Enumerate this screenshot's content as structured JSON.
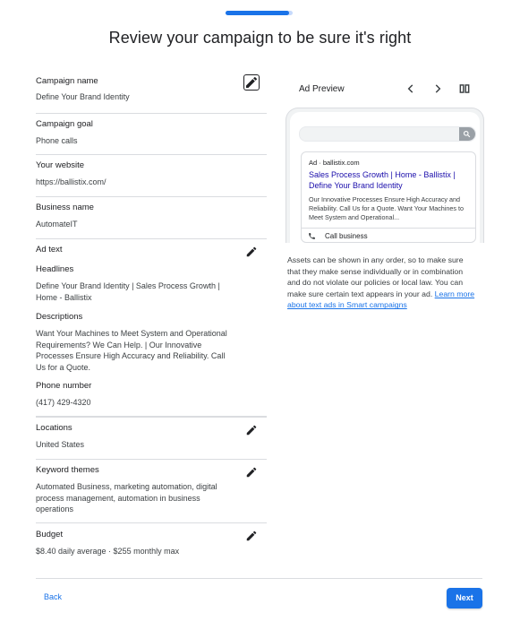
{
  "progress": {
    "fraction": 0.95
  },
  "page_title": "Review your campaign to be sure it's right",
  "sections": {
    "campaign_name": {
      "label": "Campaign name",
      "value": "Define Your Brand Identity"
    },
    "campaign_goal": {
      "label": "Campaign goal",
      "value": "Phone calls"
    },
    "website": {
      "label": "Your website",
      "value": "https://ballistix.com/"
    },
    "business_name": {
      "label": "Business name",
      "value": "AutomateIT"
    },
    "ad_text": {
      "label": "Ad text",
      "headlines_label": "Headlines",
      "headlines_value": "Define Your Brand Identity | Sales Process Growth | Home - Ballistix",
      "descriptions_label": "Descriptions",
      "descriptions_value": "Want Your Machines to Meet System and Operational Requirements? We Can Help. | Our Innovative Processes Ensure High Accuracy and Reliability. Call Us for a Quote.",
      "phone_label": "Phone number",
      "phone_value": "(417) 429-4320"
    },
    "locations": {
      "label": "Locations",
      "value": "United States"
    },
    "keyword_themes": {
      "label": "Keyword themes",
      "value": "Automated Business, marketing automation, digital process management, automation in business operations"
    },
    "budget": {
      "label": "Budget",
      "value": "$8.40 daily average · $255 monthly max"
    }
  },
  "preview": {
    "title": "Ad Preview",
    "ad_meta": "Ad · ballistix.com",
    "headline": "Sales Process Growth | Home - Ballistix | Define Your Brand Identity",
    "description": "Our Innovative Processes Ensure High Accuracy and Reliability. Call Us for a Quote. Want Your Machines to Meet System and Operational...",
    "call_label": "Call business",
    "note_text": "Assets can be shown in any order, so to make sure that they make sense individually or in combination and do not violate our policies or local law. You can make sure certain text appears in your ad. ",
    "note_link": "Learn more about text ads in Smart campaigns"
  },
  "footer": {
    "back_label": "Back",
    "next_label": "Next"
  },
  "icons": {
    "edit": "pencil-icon",
    "prev": "chevron-left-icon",
    "next": "chevron-right-icon",
    "layout": "columns-icon",
    "search": "search-icon",
    "phone": "phone-icon"
  },
  "colors": {
    "primary": "#1a73e8",
    "progress_track": "#c6dafc",
    "link": "#1a0dab",
    "divider": "#dadce0"
  }
}
